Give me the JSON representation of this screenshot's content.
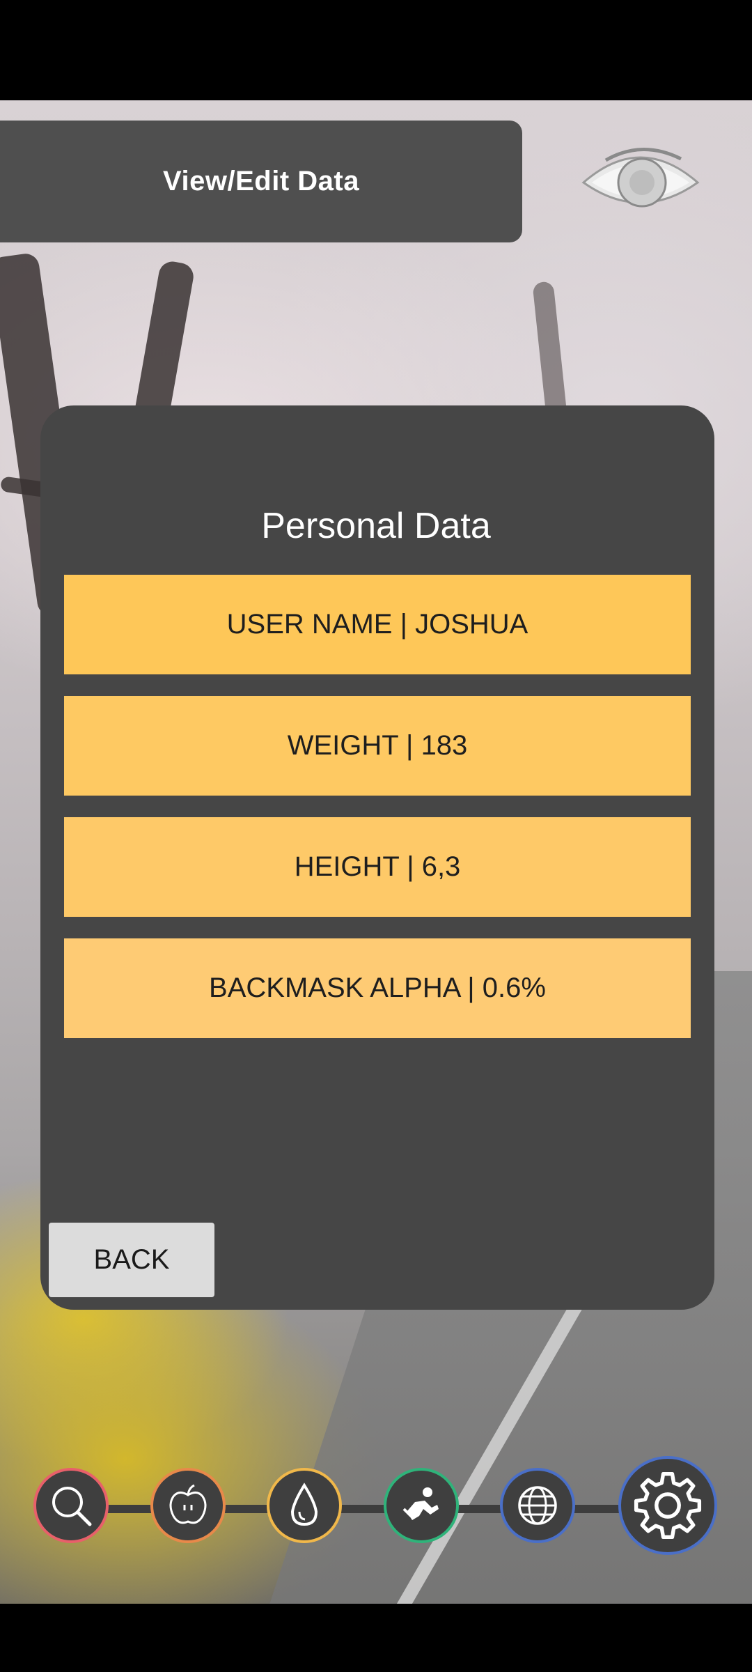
{
  "header": {
    "title": "View/Edit Data",
    "view_icon": "eye-icon"
  },
  "panel": {
    "title": "Personal Data",
    "rows": [
      {
        "label": "USER NAME | JOSHUA"
      },
      {
        "label": "WEIGHT | 183"
      },
      {
        "label": "HEIGHT | 6,3"
      },
      {
        "label": "BACKMASK ALPHA | 0.6%"
      }
    ],
    "back_label": "BACK"
  },
  "bottom_nav": [
    {
      "icon": "search-icon",
      "ring_color": "#e8606a"
    },
    {
      "icon": "apple-icon",
      "ring_color": "#e8894a"
    },
    {
      "icon": "water-drop-icon",
      "ring_color": "#f1b84a"
    },
    {
      "icon": "fitness-icon",
      "ring_color": "#2fb37a"
    },
    {
      "icon": "globe-icon",
      "ring_color": "#4a6fc8"
    },
    {
      "icon": "gear-icon",
      "ring_color": "#4a6fc8"
    }
  ],
  "colors": {
    "panel_bg": "#464646",
    "row_yellow": "#fec758",
    "back_button_bg": "#dcdcdc"
  }
}
